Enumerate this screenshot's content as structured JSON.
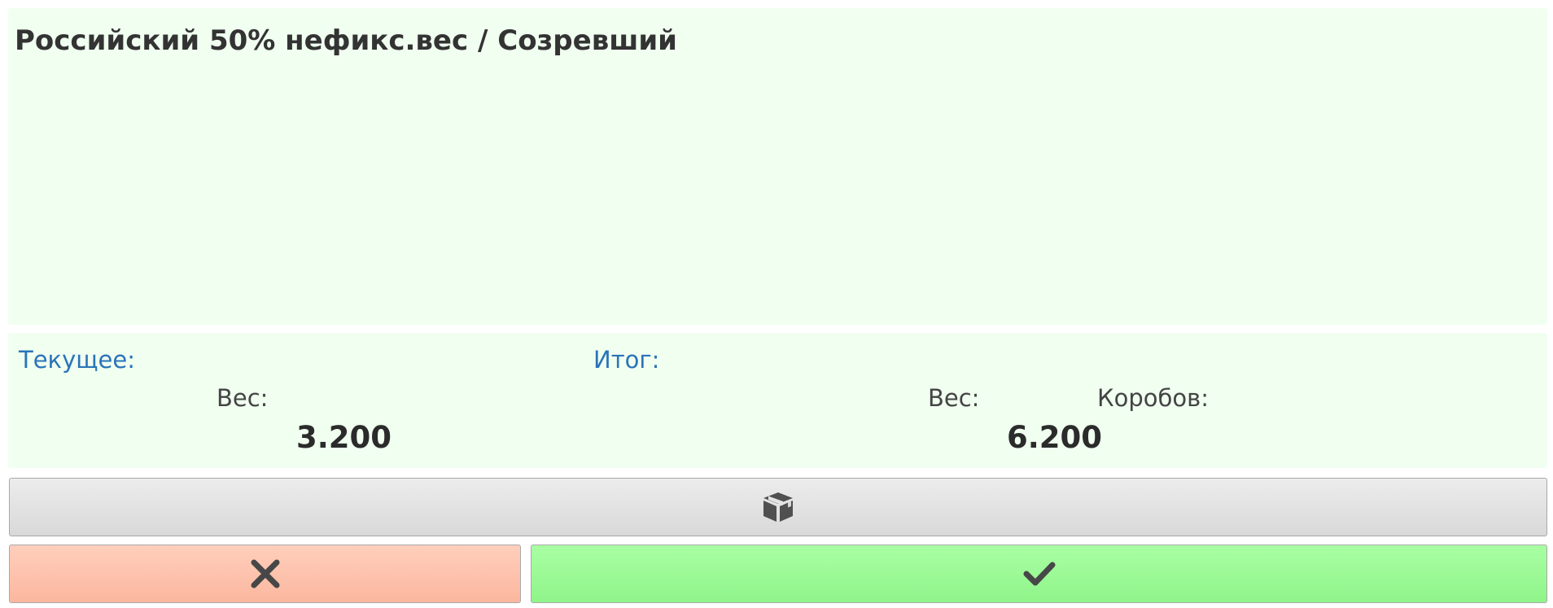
{
  "product": {
    "title": "Российский 50% нефикс.вес / Созревший"
  },
  "current": {
    "label": "Текущее:",
    "weight_label": "Вес:",
    "weight_value": "3.200"
  },
  "total": {
    "label": "Итог:",
    "weight_label": "Вес:",
    "weight_value": "6.200",
    "boxes_label": "Коробов:",
    "boxes_value": ""
  },
  "buttons": {
    "box_icon": "box-icon",
    "cancel_icon": "close-icon",
    "confirm_icon": "checkmark-icon"
  },
  "colors": {
    "panel_background": "#f0fff0",
    "section_label": "#2a74b8",
    "cancel_button": "#fbb79f",
    "confirm_button": "#8ff48a",
    "box_button": "#e0e0e0"
  }
}
